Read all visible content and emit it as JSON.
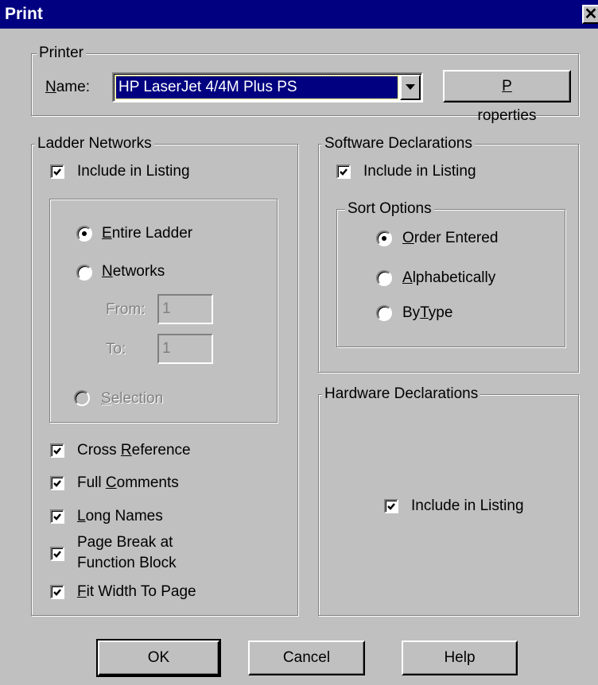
{
  "window": {
    "title": "Print",
    "close_glyph": "✕"
  },
  "printer": {
    "group_label": "Printer",
    "name_label": "Name:",
    "name_value": "HP LaserJet 4/4M Plus PS",
    "properties_button": "Properties"
  },
  "ladder": {
    "group_label": "Ladder Networks",
    "include_label": "Include in Listing",
    "include_checked": true,
    "entire_ladder": "Entire Ladder",
    "networks": "Networks",
    "from_label": "From:",
    "from_value": "1",
    "to_label": "To:",
    "to_value": "1",
    "selection": "Selection",
    "selected_range": "Entire Ladder"
  },
  "options": {
    "cross_reference": "Cross Reference",
    "full_comments": "Full Comments",
    "long_names": "Long Names",
    "page_break": [
      "Page Break at",
      "Function Block"
    ],
    "fit_width": "Fit Width To Page",
    "all_checked": true
  },
  "software": {
    "group_label": "Software Declarations",
    "include_label": "Include in Listing",
    "include_checked": true,
    "sort_group_label": "Sort Options",
    "order_entered": "Order Entered",
    "alphabetically": "Alphabetically",
    "by_type": "ByType",
    "selected_sort": "Order Entered"
  },
  "hardware": {
    "group_label": "Hardware Declarations",
    "include_label": "Include in Listing",
    "include_checked": true
  },
  "buttons": {
    "ok": "OK",
    "cancel": "Cancel",
    "help": "Help"
  },
  "icons": {
    "check": "check-icon",
    "dropdown": "chevron-down-icon",
    "close": "close-icon"
  }
}
